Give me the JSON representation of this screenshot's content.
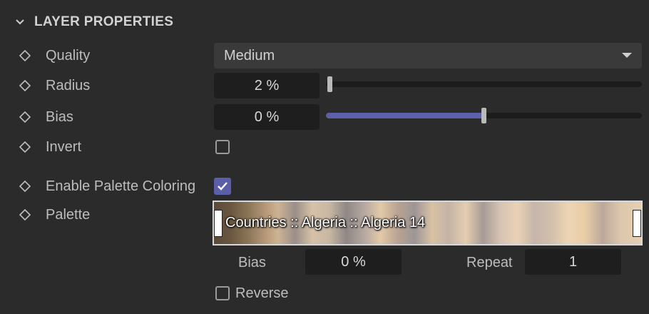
{
  "section": {
    "title": "LAYER PROPERTIES",
    "icon": "chevron-down-icon"
  },
  "properties": {
    "quality": {
      "label": "Quality",
      "value": "Medium"
    },
    "radius": {
      "label": "Radius",
      "value": "2 %",
      "slider_level": 0.02
    },
    "bias": {
      "label": "Bias",
      "value": "0 %",
      "slider_level": 0.5
    },
    "invert": {
      "label": "Invert",
      "checked": false
    },
    "enable_palette": {
      "label": "Enable Palette Coloring",
      "checked": true
    },
    "palette": {
      "label": "Palette",
      "name": "Countries :: Algeria :: Algeria 14",
      "bias_label": "Bias",
      "bias_value": "0 %",
      "repeat_label": "Repeat",
      "repeat_value": "1",
      "reverse_label": "Reverse",
      "reverse_checked": false
    }
  },
  "colors": {
    "accent": "#5c60a8",
    "background": "#2b2b2b",
    "field": "#1e1e1e"
  }
}
